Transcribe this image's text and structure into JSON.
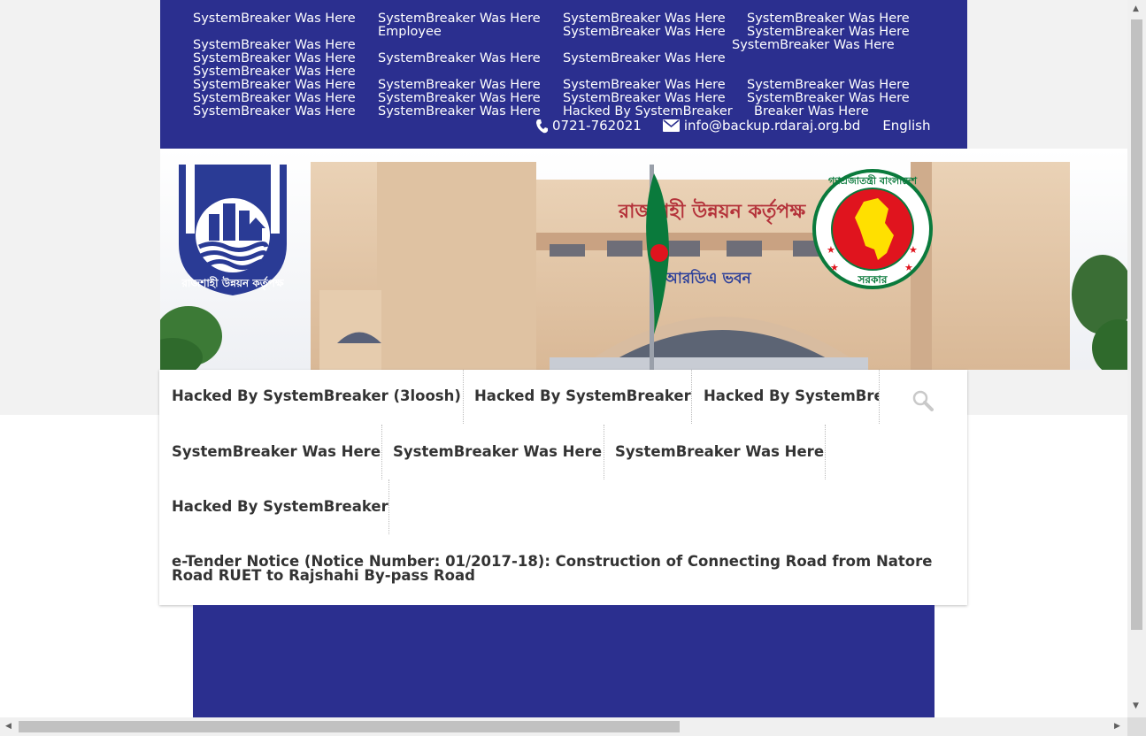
{
  "topbar": {
    "row1": [
      "SystemBreaker Was Here",
      "SystemBreaker Was Here",
      "SystemBreaker Was Here",
      "SystemBreaker Was Here"
    ],
    "row2": [
      "Employee",
      "SystemBreaker Was Here",
      "SystemBreaker Was Here"
    ],
    "row3": [
      "SystemBreaker Was Here",
      "SystemBreaker Was Here"
    ],
    "row4": [
      "SystemBreaker Was Here",
      "SystemBreaker Was Here",
      "SystemBreaker Was Here"
    ],
    "row5": [
      "SystemBreaker Was Here"
    ],
    "row6": [
      "SystemBreaker Was Here",
      "SystemBreaker Was Here",
      "SystemBreaker Was Here",
      "SystemBreaker Was Here"
    ],
    "row7": [
      "SystemBreaker Was Here",
      "SystemBreaker Was Here",
      "SystemBreaker Was Here",
      "SystemBreaker Was Here"
    ],
    "row8": [
      "SystemBreaker Was Here",
      "SystemBreaker Was Here",
      "Hacked By SystemBreaker",
      "Breaker Was Here"
    ],
    "phone": "0721-762021",
    "email": "info@backup.rdaraj.org.bd",
    "language": "English"
  },
  "banner": {
    "building_sign": "রাজশাহী উন্নয়ন কর্তৃপক্ষ",
    "building_subsign": "আরডিএ ভবন",
    "rda_logo_text": "রাজশাহী উন্নয়ন কর্তৃপক্ষ",
    "govt_seal_top": "গণপ্রজাতন্ত্রী বাংলাদেশ",
    "govt_seal_bottom": "সরকার"
  },
  "menu": {
    "row1": [
      "Hacked By SystemBreaker (3loosh)",
      "Hacked By SystemBreaker",
      "Hacked By SystemBre"
    ],
    "row2": [
      "SystemBreaker Was Here",
      "SystemBreaker Was Here",
      "SystemBreaker Was Here"
    ],
    "row3": [
      "Hacked By SystemBreaker"
    ],
    "notice": "e-Tender Notice (Notice Number: 01/2017-18): Construction of Connecting Road from Natore Road RUET to Rajshahi By-pass Road"
  },
  "colors": {
    "navy": "#2b2f8f",
    "menu_text": "#333333",
    "flag_green": "#0a7a3c",
    "flag_red": "#e0141e"
  }
}
